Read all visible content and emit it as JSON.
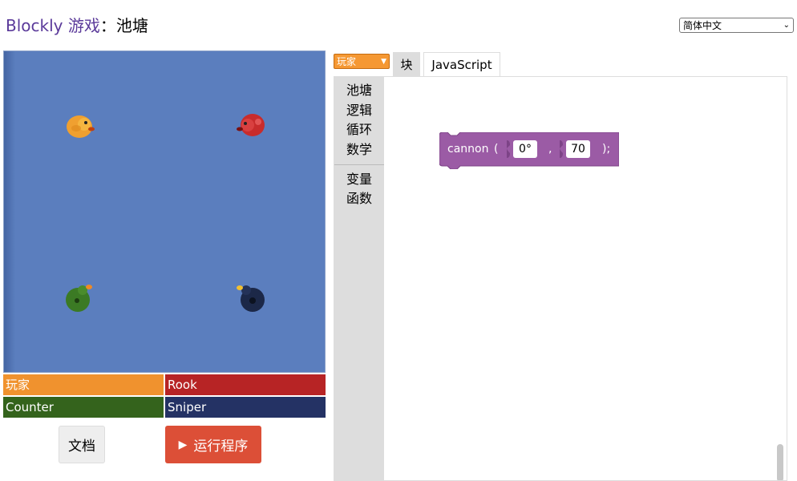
{
  "header": {
    "app_link": "Blockly 游戏",
    "separator": "：",
    "level": "池塘",
    "language": "简体中文"
  },
  "players": [
    {
      "name": "玩家",
      "color": "#f0922e"
    },
    {
      "name": "Rook",
      "color": "#b72425"
    },
    {
      "name": "Counter",
      "color": "#34631c"
    },
    {
      "name": "Sniper",
      "color": "#243264"
    }
  ],
  "pond": {
    "background": "#5b7ebe"
  },
  "buttons": {
    "docs": "文档",
    "run": "运行程序"
  },
  "editor": {
    "avatar": "玩家",
    "tabs": {
      "blocks": "块",
      "javascript": "JavaScript"
    },
    "categories": [
      "池塘",
      "逻辑",
      "循环",
      "数学",
      "变量",
      "函数"
    ],
    "block": {
      "function": "cannon",
      "open_paren": "(",
      "comma": ",",
      "close": ");",
      "angle": "0°",
      "range": "70",
      "color": "#9b5ba5"
    }
  }
}
